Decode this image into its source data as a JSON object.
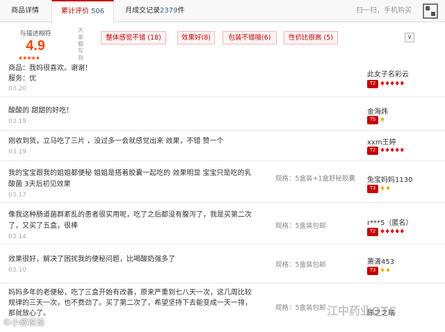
{
  "tabs": [
    {
      "label": "商品详情"
    },
    {
      "label": "累计评价",
      "count": "506"
    },
    {
      "label": "月成交记录",
      "count": "2379",
      "suffix": "件"
    }
  ],
  "scan_text": "扫一扫，手机购买",
  "summary": {
    "label": "与描述相符",
    "score": "4.9",
    "stars": "★★★★★",
    "vertical_label": "大家都写到",
    "tags": [
      "整体感觉不错 (18)",
      "效果好(8)",
      "包装不错哦(6)",
      "性价比很高 (5)"
    ],
    "toggle": "∨"
  },
  "reviews": [
    {
      "text": "商品：我妈很喜欢。谢谢！",
      "sub": "服务：优",
      "date": "03.20",
      "spec": "",
      "user": "此女子名彩云",
      "level": "T2",
      "gems": "♦♦♦♦♦"
    },
    {
      "text": "酸酸的 甜甜的好吃！",
      "sub": "",
      "date": "03.19",
      "spec": "",
      "user": "金海炜",
      "level": "T5",
      "gems": "♦"
    },
    {
      "text": "刚收到货，立马吃了三片 ，没过多一会就感觉出来 效果，不错 赞一个",
      "sub": "",
      "date": "03.19",
      "spec": "",
      "user": "xxm王婷",
      "level": "T2",
      "gems": "♦♦♦♦♦"
    },
    {
      "text": "我的宝宝跟我的姐姐都便秘 姐姐是搭着胶囊一起吃的 效果明显 宝宝只是吃的乳",
      "sub": "酸菌 3天后初见效果",
      "date": "03.17",
      "spec": "规格：5盒装+1盒舒秘胶囊",
      "user": "兔宝妈妈1130",
      "level": "T3",
      "gems": "♦♦"
    },
    {
      "text": "像我这种肠道菌群紊乱的患者很实用呢，吃了之后都没有腹泻了，我是买第二次",
      "sub": "了，又买了五盒，很棒",
      "date": "03.14",
      "spec": "规格：5盒装包邮",
      "user": "r***5（匿名）",
      "level": "T2",
      "gems": "♦♦♦♦♦"
    },
    {
      "text": "效果很好，解决了困扰我的便秘问题，比喝酸奶强多了",
      "sub": "",
      "date": "03.10",
      "spec": "规格：5盒装包邮",
      "user": "萧潇453",
      "level": "T3",
      "gems": "♦♦"
    },
    {
      "text": "妈妈多年的老便秘，吃了三盒开始有改善，原来严重到七八天一次，这几周比较",
      "sub": "规律的三天一次，也不费劲了。买了第二次了，希望坚持下去能变成一天一排，",
      "sub2": "那就放心了。",
      "date": "",
      "spec": "规格：5盒装包邮",
      "user": "陈之之瑞",
      "level": "",
      "gems": ""
    }
  ],
  "watermark_left": "©小叔说说",
  "watermark_right": "江中药业OTC"
}
